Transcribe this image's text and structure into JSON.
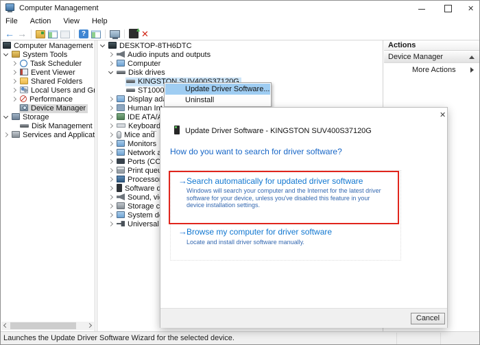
{
  "window": {
    "title": "Computer Management"
  },
  "menu_bar": {
    "items": [
      "File",
      "Action",
      "View",
      "Help"
    ]
  },
  "toolbar": {
    "icons": [
      "back",
      "forward",
      "sep",
      "export-list",
      "show-console-tree",
      "show-console-tree-disabled",
      "sep",
      "help",
      "console-window",
      "sep",
      "remote-computer",
      "sep",
      "update-driver",
      "uninstall-device"
    ]
  },
  "left_tree": {
    "items": [
      {
        "label": "Computer Management (Local",
        "icon": "computer-management",
        "level": "root",
        "expander": "none",
        "selected": ""
      },
      {
        "label": "System Tools",
        "icon": "system-tools",
        "level": "l0",
        "expander": "open",
        "selected": ""
      },
      {
        "label": "Task Scheduler",
        "icon": "task-scheduler",
        "level": "l1",
        "expander": "closed",
        "selected": ""
      },
      {
        "label": "Event Viewer",
        "icon": "event-viewer",
        "level": "l1",
        "expander": "closed",
        "selected": ""
      },
      {
        "label": "Shared Folders",
        "icon": "shared-folders",
        "level": "l1",
        "expander": "closed",
        "selected": ""
      },
      {
        "label": "Local Users and Groups",
        "icon": "local-users-groups",
        "level": "l1",
        "expander": "closed",
        "selected": ""
      },
      {
        "label": "Performance",
        "icon": "performance",
        "level": "l1",
        "expander": "closed",
        "selected": ""
      },
      {
        "label": "Device Manager",
        "icon": "device-manager",
        "level": "l1",
        "expander": "none",
        "selected": "inactive"
      },
      {
        "label": "Storage",
        "icon": "storage",
        "level": "l0",
        "expander": "open",
        "selected": ""
      },
      {
        "label": "Disk Management",
        "icon": "disk-management",
        "level": "l1",
        "expander": "none",
        "selected": ""
      },
      {
        "label": "Services and Applications",
        "icon": "services-applications",
        "level": "l0",
        "expander": "closed",
        "selected": ""
      }
    ]
  },
  "device_tree": {
    "items": [
      {
        "label": "DESKTOP-8TH6DTC",
        "icon": "computer",
        "level": "l0",
        "expander": "open",
        "selected": ""
      },
      {
        "label": "Audio inputs and outputs",
        "icon": "speaker",
        "level": "l1",
        "expander": "closed",
        "selected": ""
      },
      {
        "label": "Computer",
        "icon": "monitor",
        "level": "l1",
        "expander": "closed",
        "selected": ""
      },
      {
        "label": "Disk drives",
        "icon": "disk-drive",
        "level": "l1",
        "expander": "open",
        "selected": ""
      },
      {
        "label": "KINGSTON SUV400S37120G",
        "icon": "disk-drive",
        "level": "l2",
        "expander": "none",
        "selected": "active"
      },
      {
        "label": "ST1000D",
        "icon": "disk-drive",
        "level": "l2",
        "expander": "none",
        "selected": ""
      },
      {
        "label": "Display ada",
        "icon": "display-adapter",
        "level": "l1",
        "expander": "closed",
        "selected": ""
      },
      {
        "label": "Human Int",
        "icon": "hid-device",
        "level": "l1",
        "expander": "closed",
        "selected": ""
      },
      {
        "label": "IDE ATA/A",
        "icon": "ide-controller",
        "level": "l1",
        "expander": "closed",
        "selected": ""
      },
      {
        "label": "Keyboards",
        "icon": "keyboard",
        "level": "l1",
        "expander": "closed",
        "selected": ""
      },
      {
        "label": "Mice and",
        "icon": "mouse",
        "level": "l1",
        "expander": "closed",
        "selected": ""
      },
      {
        "label": "Monitors",
        "icon": "monitor",
        "level": "l1",
        "expander": "closed",
        "selected": ""
      },
      {
        "label": "Network a",
        "icon": "network-adapter",
        "level": "l1",
        "expander": "closed",
        "selected": ""
      },
      {
        "label": "Ports (CO",
        "icon": "port",
        "level": "l1",
        "expander": "closed",
        "selected": ""
      },
      {
        "label": "Print queu",
        "icon": "printer",
        "level": "l1",
        "expander": "closed",
        "selected": ""
      },
      {
        "label": "Processor",
        "icon": "processor",
        "level": "l1",
        "expander": "closed",
        "selected": ""
      },
      {
        "label": "Software d",
        "icon": "software-device",
        "level": "l1",
        "expander": "closed",
        "selected": ""
      },
      {
        "label": "Sound, vid",
        "icon": "sound-controller",
        "level": "l1",
        "expander": "closed",
        "selected": ""
      },
      {
        "label": "Storage co",
        "icon": "storage-controller",
        "level": "l1",
        "expander": "closed",
        "selected": ""
      },
      {
        "label": "System de",
        "icon": "system-device",
        "level": "l1",
        "expander": "closed",
        "selected": ""
      },
      {
        "label": "Universal",
        "icon": "usb-controller",
        "level": "l1",
        "expander": "closed",
        "selected": ""
      }
    ]
  },
  "context_menu": {
    "items": [
      {
        "label": "Update Driver Software...",
        "highlighted": true
      },
      {
        "label": "Uninstall",
        "highlighted": false
      }
    ]
  },
  "actions_panel": {
    "title": "Actions",
    "group_title": "Device Manager",
    "more_actions_label": "More Actions"
  },
  "wizard": {
    "title": "Update Driver Software - KINGSTON SUV400S37120G",
    "heading": "How do you want to search for driver software?",
    "options": [
      {
        "title": "Search automatically for updated driver software",
        "description": "Windows will search your computer and the Internet for the latest driver software for your device, unless you've disabled this feature in your device installation settings."
      },
      {
        "title": "Browse my computer for driver software",
        "description": "Locate and install driver software manually."
      }
    ],
    "cancel_label": "Cancel"
  },
  "status_bar": {
    "text": "Launches the Update Driver Software Wizard for the selected device."
  },
  "colors": {
    "heading_blue": "#1565c6",
    "option_title_blue": "#0f76d0",
    "description_blue": "#3468b0",
    "red_annotation": "#e0251c",
    "selection_active": "#cce4f7",
    "selection_inactive": "#d9d9d9",
    "menu_highlight": "#9fcdf2"
  }
}
